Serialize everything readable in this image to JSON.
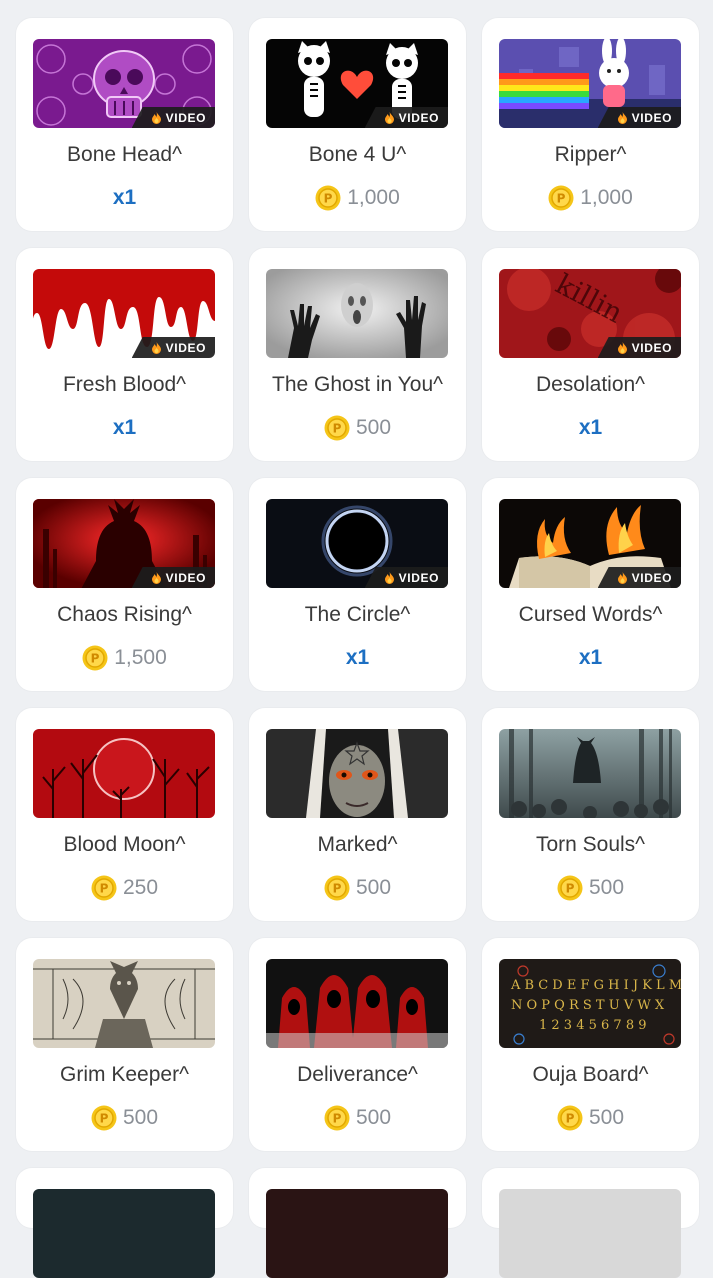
{
  "video_badge_label": "VIDEO",
  "colors": {
    "qty_blue": "#1d6fc2",
    "coin_gold": "#f5c518",
    "price_gray": "#8a8f96"
  },
  "items": [
    {
      "title": "Bone Head^",
      "price_type": "qty",
      "price": "x1",
      "video": true,
      "thumb": "sugar-skull-purple"
    },
    {
      "title": "Bone 4 U^",
      "price_type": "coin",
      "price": "1,000",
      "video": true,
      "thumb": "skeleton-cats-heart"
    },
    {
      "title": "Ripper^",
      "price_type": "coin",
      "price": "1,000",
      "video": true,
      "thumb": "bunny-rainbow-graveyard"
    },
    {
      "title": "Fresh Blood^",
      "price_type": "qty",
      "price": "x1",
      "video": true,
      "thumb": "dripping-blood"
    },
    {
      "title": "The Ghost in You^",
      "price_type": "coin",
      "price": "500",
      "video": false,
      "thumb": "ghost-behind-glass"
    },
    {
      "title": "Desolation^",
      "price_type": "qty",
      "price": "x1",
      "video": true,
      "thumb": "killing-paper-red"
    },
    {
      "title": "Chaos Rising^",
      "price_type": "coin",
      "price": "1,500",
      "video": true,
      "thumb": "red-demon"
    },
    {
      "title": "The Circle^",
      "price_type": "qty",
      "price": "x1",
      "video": true,
      "thumb": "black-ring-glow"
    },
    {
      "title": "Cursed Words^",
      "price_type": "qty",
      "price": "x1",
      "video": true,
      "thumb": "burning-book"
    },
    {
      "title": "Blood Moon^",
      "price_type": "coin",
      "price": "250",
      "video": false,
      "thumb": "red-moon-forest"
    },
    {
      "title": "Marked^",
      "price_type": "coin",
      "price": "500",
      "video": false,
      "thumb": "possessed-nun"
    },
    {
      "title": "Torn Souls^",
      "price_type": "coin",
      "price": "500",
      "video": false,
      "thumb": "misty-forest-figure"
    },
    {
      "title": "Grim Keeper^",
      "price_type": "coin",
      "price": "500",
      "video": false,
      "thumb": "goat-demon-engraving"
    },
    {
      "title": "Deliverance^",
      "price_type": "coin",
      "price": "500",
      "video": false,
      "thumb": "red-hooded-cult"
    },
    {
      "title": "Ouja Board^",
      "price_type": "coin",
      "price": "500",
      "video": false,
      "thumb": "ouija-board"
    }
  ],
  "partial_row_count": 3
}
